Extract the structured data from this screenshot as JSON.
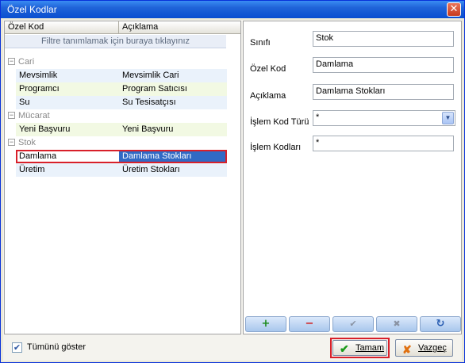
{
  "window": {
    "title": "Özel Kodlar",
    "close_glyph": "✕"
  },
  "grid": {
    "columns": [
      "Özel Kod",
      "Açıklama"
    ],
    "filter_placeholder": "Filtre tanımlamak için buraya tıklayınız",
    "groups": [
      {
        "name": "Cari",
        "rows": [
          {
            "code": "Mevsimlik",
            "desc": "Mevsimlik Cari"
          },
          {
            "code": "Programcı",
            "desc": "Program Satıcısı"
          },
          {
            "code": "Su",
            "desc": "Su Tesisatçısı"
          }
        ]
      },
      {
        "name": "Mücarat",
        "rows": [
          {
            "code": "Yeni Başvuru",
            "desc": "Yeni Başvuru"
          }
        ]
      },
      {
        "name": "Stok",
        "rows": [
          {
            "code": "Damlama",
            "desc": "Damlama Stokları"
          },
          {
            "code": "Üretim",
            "desc": "Üretim Stokları"
          }
        ]
      }
    ],
    "collapse_glyph": "−"
  },
  "form": {
    "sinifi_label": "Sınıfı",
    "sinifi_value": "Stok",
    "ozel_kod_label": "Özel Kod",
    "ozel_kod_value": "Damlama",
    "aciklama_label": "Açıklama",
    "aciklama_value": "Damlama Stokları",
    "islem_kod_turu_label": "İşlem Kod Türü",
    "islem_kod_turu_value": "*",
    "islem_kodlari_label": "İşlem Kodları",
    "islem_kodlari_value": "*"
  },
  "toolbar": {
    "add_icon": "+",
    "remove_icon": "−",
    "confirm_icon": "✔",
    "cancel_icon": "✖",
    "refresh_icon": "↻",
    "colors": {
      "add": "#1a8a1a",
      "remove": "#d01818",
      "disabled": "#8a93a3",
      "refresh": "#2b5fb3"
    }
  },
  "footer": {
    "show_all_label": "Tümünü göster",
    "show_all_checked": true,
    "ok_label": "Tamam",
    "cancel_label": "Vazgeç"
  }
}
